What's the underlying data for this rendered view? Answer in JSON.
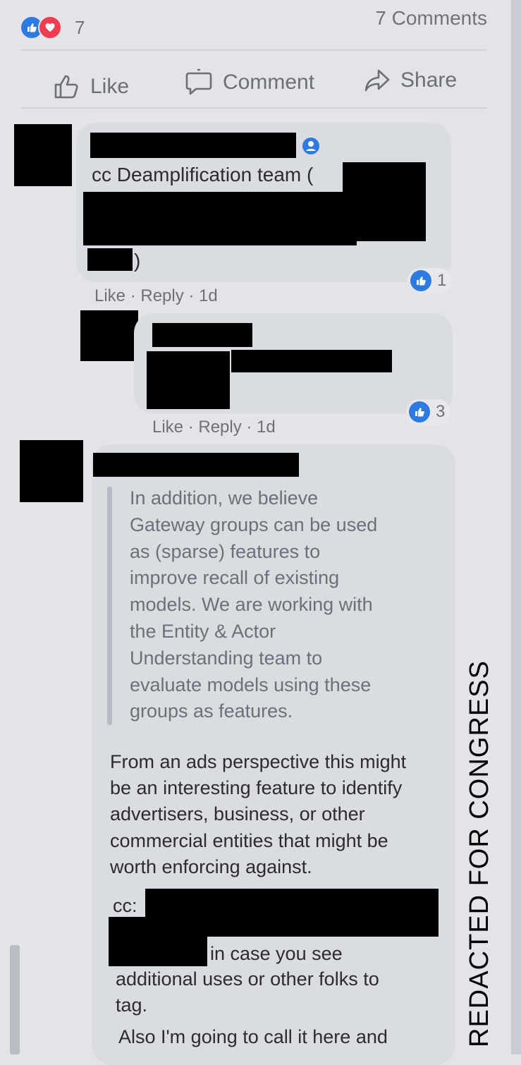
{
  "post": {
    "reactions_count": "7",
    "comments_count": "7 Comments",
    "actions": {
      "like": "Like",
      "comment": "Comment",
      "share": "Share"
    }
  },
  "comments": [
    {
      "text_start": "cc Deamplification team (",
      "text_end": ")",
      "actions": "Like · Reply · 1d",
      "likes": "1"
    },
    {
      "actions": "Like · Reply · 1d",
      "likes": "3"
    },
    {
      "quote_lines": [
        "In addition, we believe",
        "Gateway groups can be used",
        "as (sparse) features to",
        "improve recall of existing",
        "models. We are working with",
        "the Entity & Actor",
        "Understanding team to",
        "evaluate models using these",
        "groups as features."
      ],
      "para_lines": [
        "From an ads perspective this might",
        "be an interesting feature to identify",
        "advertisers, business, or other",
        "commercial entities that might be",
        "worth enforcing against."
      ],
      "cc_label": "cc:",
      "cc_tail": "in case you see",
      "cc_lines": [
        "additional uses or other folks to",
        "tag."
      ],
      "last_line": "Also I'm going to call it here and"
    }
  ],
  "watermark": "REDACTED FOR CONGRESS",
  "colors": {
    "like_blue": "#2d7be0",
    "love_red": "#ee3c51",
    "page_bg": "#e2e4e8",
    "bubble_bg": "#d9dce1"
  },
  "icons": [
    "like-reaction-icon",
    "love-reaction-icon",
    "thumbs-up-icon",
    "speech-bubble-icon",
    "share-arrow-icon",
    "verified-badge-icon"
  ]
}
